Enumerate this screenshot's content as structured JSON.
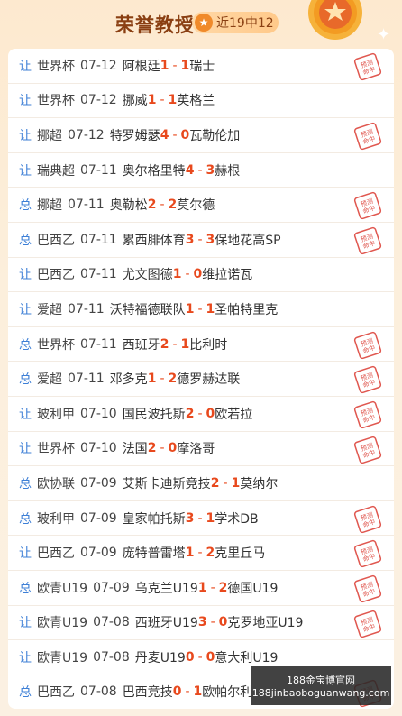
{
  "header": {
    "title": "荣誉教授",
    "badge_icon": "star-icon",
    "badge_text": "近19中12"
  },
  "stamp_text": "预测命中",
  "rows": [
    {
      "type": "让",
      "league": "世界杯",
      "date": "07-12",
      "home": "阿根廷",
      "hs": "1",
      "as": "1",
      "away": "瑞士",
      "hit": true
    },
    {
      "type": "让",
      "league": "世界杯",
      "date": "07-12",
      "home": "挪威",
      "hs": "1",
      "as": "1",
      "away": "英格兰",
      "hit": false
    },
    {
      "type": "让",
      "league": "挪超",
      "date": "07-12",
      "home": "特罗姆瑟",
      "hs": "4",
      "as": "0",
      "away": "瓦勒伦加",
      "hit": true
    },
    {
      "type": "让",
      "league": "瑞典超",
      "date": "07-11",
      "home": "奥尔格里特",
      "hs": "4",
      "as": "3",
      "away": "赫根",
      "hit": false
    },
    {
      "type": "总",
      "league": "挪超",
      "date": "07-11",
      "home": "奥勒松",
      "hs": "2",
      "as": "2",
      "away": "莫尔德",
      "hit": true
    },
    {
      "type": "总",
      "league": "巴西乙",
      "date": "07-11",
      "home": "累西腓体育",
      "hs": "3",
      "as": "3",
      "away": "保地花高SP",
      "hit": true
    },
    {
      "type": "让",
      "league": "巴西乙",
      "date": "07-11",
      "home": "尤文图德",
      "hs": "1",
      "as": "0",
      "away": "维拉诺瓦",
      "hit": false
    },
    {
      "type": "让",
      "league": "爱超",
      "date": "07-11",
      "home": "沃特福德联队",
      "hs": "1",
      "as": "1",
      "away": "圣帕特里克",
      "hit": false
    },
    {
      "type": "总",
      "league": "世界杯",
      "date": "07-11",
      "home": "西班牙",
      "hs": "2",
      "as": "1",
      "away": "比利时",
      "hit": true
    },
    {
      "type": "总",
      "league": "爱超",
      "date": "07-11",
      "home": "邓多克",
      "hs": "1",
      "as": "2",
      "away": "德罗赫达联",
      "hit": true
    },
    {
      "type": "让",
      "league": "玻利甲",
      "date": "07-10",
      "home": "国民波托斯",
      "hs": "2",
      "as": "0",
      "away": "欧若拉",
      "hit": true
    },
    {
      "type": "让",
      "league": "世界杯",
      "date": "07-10",
      "home": "法国",
      "hs": "2",
      "as": "0",
      "away": "摩洛哥",
      "hit": true
    },
    {
      "type": "总",
      "league": "欧协联",
      "date": "07-09",
      "home": "艾斯卡迪斯竞技",
      "hs": "2",
      "as": "1",
      "away": "莫纳尔",
      "hit": false
    },
    {
      "type": "总",
      "league": "玻利甲",
      "date": "07-09",
      "home": "皇家帕托斯",
      "hs": "3",
      "as": "1",
      "away": "学术DB",
      "hit": true
    },
    {
      "type": "让",
      "league": "巴西乙",
      "date": "07-09",
      "home": "庞特普雷塔",
      "hs": "1",
      "as": "2",
      "away": "克里丘马",
      "hit": true
    },
    {
      "type": "总",
      "league": "欧青U19",
      "date": "07-09",
      "home": "乌克兰U19",
      "hs": "1",
      "as": "2",
      "away": "德国U19",
      "hit": true
    },
    {
      "type": "让",
      "league": "欧青U19",
      "date": "07-08",
      "home": "西班牙U19",
      "hs": "3",
      "as": "0",
      "away": "克罗地亚U19",
      "hit": true
    },
    {
      "type": "让",
      "league": "欧青U19",
      "date": "07-08",
      "home": "丹麦U19",
      "hs": "0",
      "as": "0",
      "away": "意大利U19",
      "hit": false
    },
    {
      "type": "总",
      "league": "巴西乙",
      "date": "07-08",
      "home": "巴西竞技",
      "hs": "0",
      "as": "1",
      "away": "欧帕尔利",
      "hit": true
    }
  ],
  "watermark": {
    "line1": "188金宝博官网",
    "line2": "188jinbaoboguanwang.com"
  }
}
